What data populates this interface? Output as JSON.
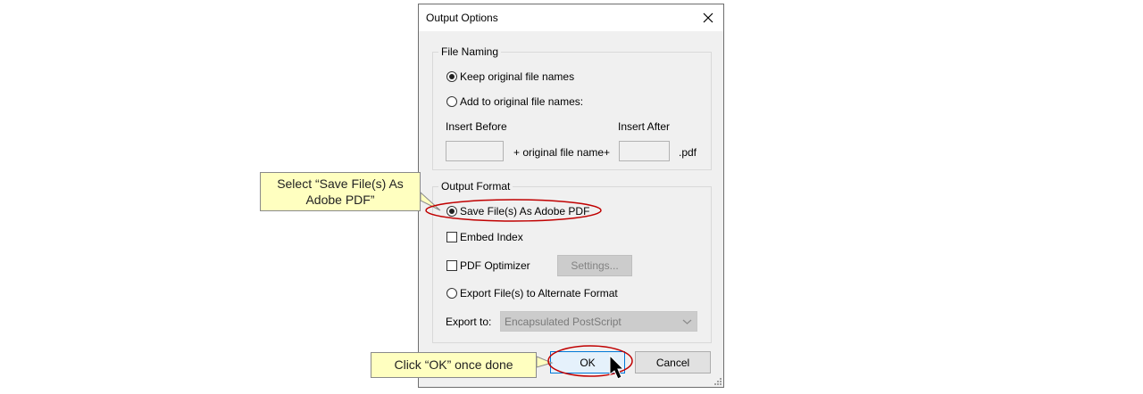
{
  "dialog": {
    "title": "Output Options",
    "file_naming": {
      "legend": "File Naming",
      "keep_original": "Keep original file names",
      "add_to_original": "Add to original file names:",
      "insert_before_label": "Insert Before",
      "insert_after_label": "Insert After",
      "insert_before_value": "",
      "insert_after_value": "",
      "original_file_name_text": "+ original file name+",
      "extension": ".pdf"
    },
    "output_format": {
      "legend": "Output Format",
      "save_as_pdf": "Save File(s) As Adobe PDF",
      "embed_index": "Embed Index",
      "pdf_optimizer": "PDF Optimizer",
      "settings_button": "Settings...",
      "export_alternate": "Export File(s) to Alternate Format",
      "export_to_label": "Export to:",
      "export_to_value": "Encapsulated PostScript"
    },
    "ok_button": "OK",
    "cancel_button": "Cancel"
  },
  "callouts": {
    "select_pdf_line1": "Select “Save File(s) As",
    "select_pdf_line2": "Adobe PDF”",
    "click_ok": "Click “OK” once done"
  },
  "colors": {
    "highlight_ring": "#c00000",
    "callout_fill": "#ffffc0",
    "dialog_bg": "#f0f0f0",
    "default_button_border": "#0078d7"
  }
}
